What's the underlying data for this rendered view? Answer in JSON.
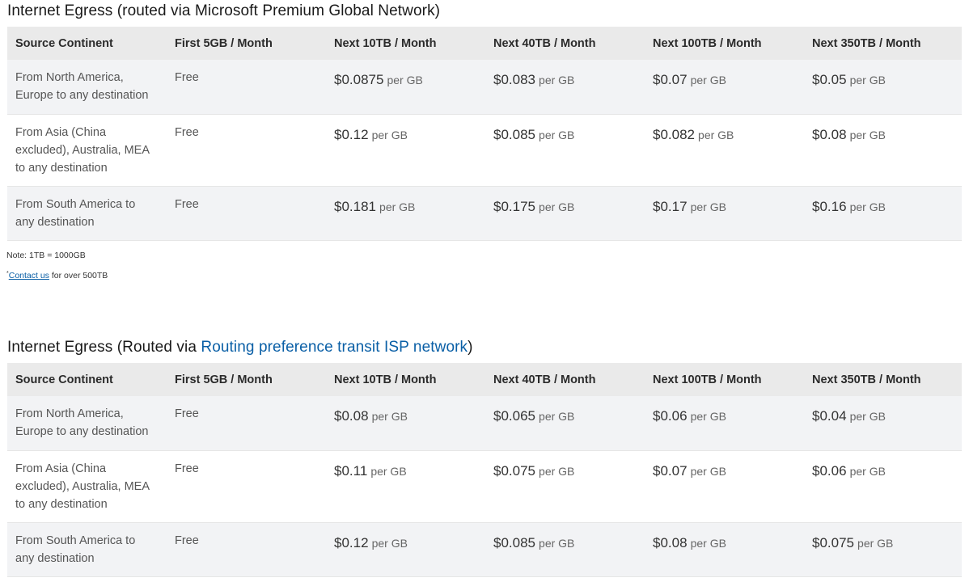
{
  "sections": [
    {
      "title": "Internet Egress (routed via Microsoft Premium Global Network)",
      "columns": [
        "Source Continent",
        "First 5GB / Month",
        "Next 10TB / Month",
        "Next 40TB / Month",
        "Next 100TB / Month",
        "Next 350TB / Month"
      ],
      "rows": [
        {
          "source": [
            "From North America,",
            "Europe to any destination"
          ],
          "free": "Free",
          "prices": [
            "$0.0875",
            "$0.083",
            "$0.07",
            "$0.05"
          ]
        },
        {
          "source": [
            "From Asia (China",
            "excluded), Australia, MEA",
            "to any destination"
          ],
          "free": "Free",
          "prices": [
            "$0.12",
            "$0.085",
            "$0.082",
            "$0.08"
          ]
        },
        {
          "source": [
            "From South America to",
            "any destination"
          ],
          "free": "Free",
          "prices": [
            "$0.181",
            "$0.175",
            "$0.17",
            "$0.16"
          ]
        }
      ]
    },
    {
      "title_prefix": "Internet Egress (Routed via ",
      "title_link": "Routing preference transit ISP network",
      "title_suffix": ")",
      "columns": [
        "Source Continent",
        "First 5GB / Month",
        "Next 10TB / Month",
        "Next 40TB / Month",
        "Next 100TB / Month",
        "Next 350TB / Month"
      ],
      "rows": [
        {
          "source": [
            "From North America,",
            "Europe to any destination"
          ],
          "free": "Free",
          "prices": [
            "$0.08",
            "$0.065",
            "$0.06",
            "$0.04"
          ]
        },
        {
          "source": [
            "From Asia (China",
            "excluded), Australia, MEA",
            "to any destination"
          ],
          "free": "Free",
          "prices": [
            "$0.11",
            "$0.075",
            "$0.07",
            "$0.06"
          ]
        },
        {
          "source": [
            "From South America to",
            "any destination"
          ],
          "free": "Free",
          "prices": [
            "$0.12",
            "$0.085",
            "$0.08",
            "$0.075"
          ]
        }
      ]
    }
  ],
  "unit_label": "per GB",
  "notes": {
    "tb_note": "Note: 1TB = 1000GB",
    "contact_marker": "*",
    "contact_link": "Contact us",
    "contact_suffix": " for over 500TB"
  }
}
